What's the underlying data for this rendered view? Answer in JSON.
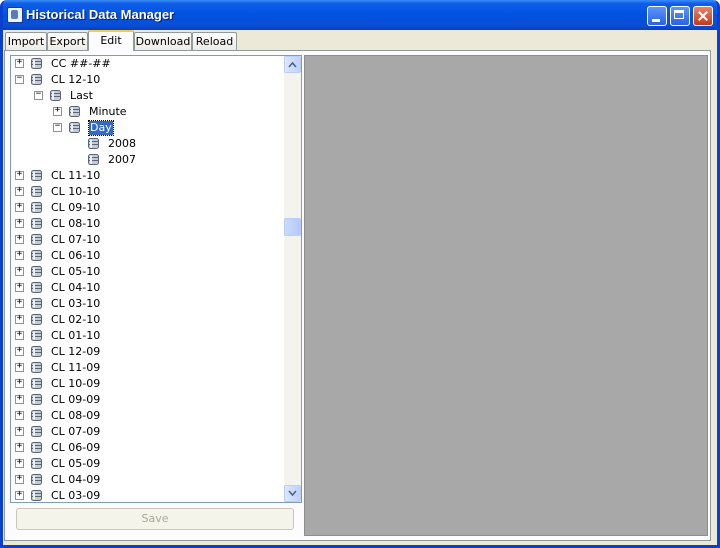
{
  "window": {
    "title": "Historical Data Manager"
  },
  "tabs": [
    {
      "label": "Import"
    },
    {
      "label": "Export"
    },
    {
      "label": "Edit"
    },
    {
      "label": "Download"
    },
    {
      "label": "Reload"
    }
  ],
  "active_tab": "Edit",
  "tree": [
    {
      "label": "CC ##-##",
      "level": 0,
      "expander": "+",
      "selected": false
    },
    {
      "label": "CL 12-10",
      "level": 0,
      "expander": "-",
      "selected": false
    },
    {
      "label": "Last",
      "level": 1,
      "expander": "-",
      "selected": false
    },
    {
      "label": "Minute",
      "level": 2,
      "expander": "+",
      "selected": false
    },
    {
      "label": "Day",
      "level": 2,
      "expander": "-",
      "selected": true
    },
    {
      "label": "2008",
      "level": 3,
      "expander": "",
      "selected": false
    },
    {
      "label": "2007",
      "level": 3,
      "expander": "",
      "selected": false
    },
    {
      "label": "CL 11-10",
      "level": 0,
      "expander": "+",
      "selected": false
    },
    {
      "label": "CL 10-10",
      "level": 0,
      "expander": "+",
      "selected": false
    },
    {
      "label": "CL 09-10",
      "level": 0,
      "expander": "+",
      "selected": false
    },
    {
      "label": "CL 08-10",
      "level": 0,
      "expander": "+",
      "selected": false
    },
    {
      "label": "CL 07-10",
      "level": 0,
      "expander": "+",
      "selected": false
    },
    {
      "label": "CL 06-10",
      "level": 0,
      "expander": "+",
      "selected": false
    },
    {
      "label": "CL 05-10",
      "level": 0,
      "expander": "+",
      "selected": false
    },
    {
      "label": "CL 04-10",
      "level": 0,
      "expander": "+",
      "selected": false
    },
    {
      "label": "CL 03-10",
      "level": 0,
      "expander": "+",
      "selected": false
    },
    {
      "label": "CL 02-10",
      "level": 0,
      "expander": "+",
      "selected": false
    },
    {
      "label": "CL 01-10",
      "level": 0,
      "expander": "+",
      "selected": false
    },
    {
      "label": "CL 12-09",
      "level": 0,
      "expander": "+",
      "selected": false
    },
    {
      "label": "CL 11-09",
      "level": 0,
      "expander": "+",
      "selected": false
    },
    {
      "label": "CL 10-09",
      "level": 0,
      "expander": "+",
      "selected": false
    },
    {
      "label": "CL 09-09",
      "level": 0,
      "expander": "+",
      "selected": false
    },
    {
      "label": "CL 08-09",
      "level": 0,
      "expander": "+",
      "selected": false
    },
    {
      "label": "CL 07-09",
      "level": 0,
      "expander": "+",
      "selected": false
    },
    {
      "label": "CL 06-09",
      "level": 0,
      "expander": "+",
      "selected": false
    },
    {
      "label": "CL 05-09",
      "level": 0,
      "expander": "+",
      "selected": false
    },
    {
      "label": "CL 04-09",
      "level": 0,
      "expander": "+",
      "selected": false
    },
    {
      "label": "CL 03-09",
      "level": 0,
      "expander": "+",
      "selected": false
    }
  ],
  "save_button": {
    "label": "Save",
    "enabled": false
  },
  "icons": {
    "node": "database-icon",
    "expand": "plus-box-icon",
    "collapse": "minus-box-icon"
  },
  "colors": {
    "selection": "#316ac5",
    "titlebar": "#0052e0",
    "preview_panel": "#a8a8a8"
  }
}
